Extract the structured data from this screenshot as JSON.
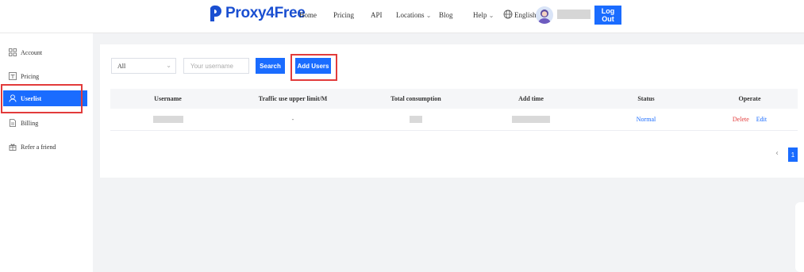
{
  "brand": {
    "name": "Proxy4Free",
    "color": "#1a4fd1",
    "accent": "#1a6cff"
  },
  "nav": {
    "home": "Home",
    "pricing": "Pricing",
    "api": "API",
    "locations": "Locations",
    "blog": "Blog",
    "help": "Help",
    "language": "English",
    "logout": "Log Out"
  },
  "sidebar": {
    "items": [
      {
        "label": "Account",
        "icon": "account-icon"
      },
      {
        "label": "Pricing",
        "icon": "pricing-icon"
      },
      {
        "label": "Userlist",
        "icon": "user-icon",
        "active": true
      },
      {
        "label": "Billing",
        "icon": "billing-icon"
      },
      {
        "label": "Refer a friend",
        "icon": "gift-icon"
      }
    ]
  },
  "filter": {
    "select_value": "All",
    "username_placeholder": "Your username",
    "search_label": "Search",
    "add_users_label": "Add Users"
  },
  "table": {
    "columns": [
      "Username",
      "Traffic use upper limit/M",
      "Total consumption",
      "Add time",
      "Status",
      "Operate"
    ],
    "rows": [
      {
        "traffic_limit": "-",
        "status": "Normal",
        "actions": [
          "Delete",
          "Edit"
        ]
      }
    ]
  },
  "pagination": {
    "current": "1"
  },
  "colors": {
    "danger": "#e23b3b",
    "link": "#1a6cff"
  }
}
